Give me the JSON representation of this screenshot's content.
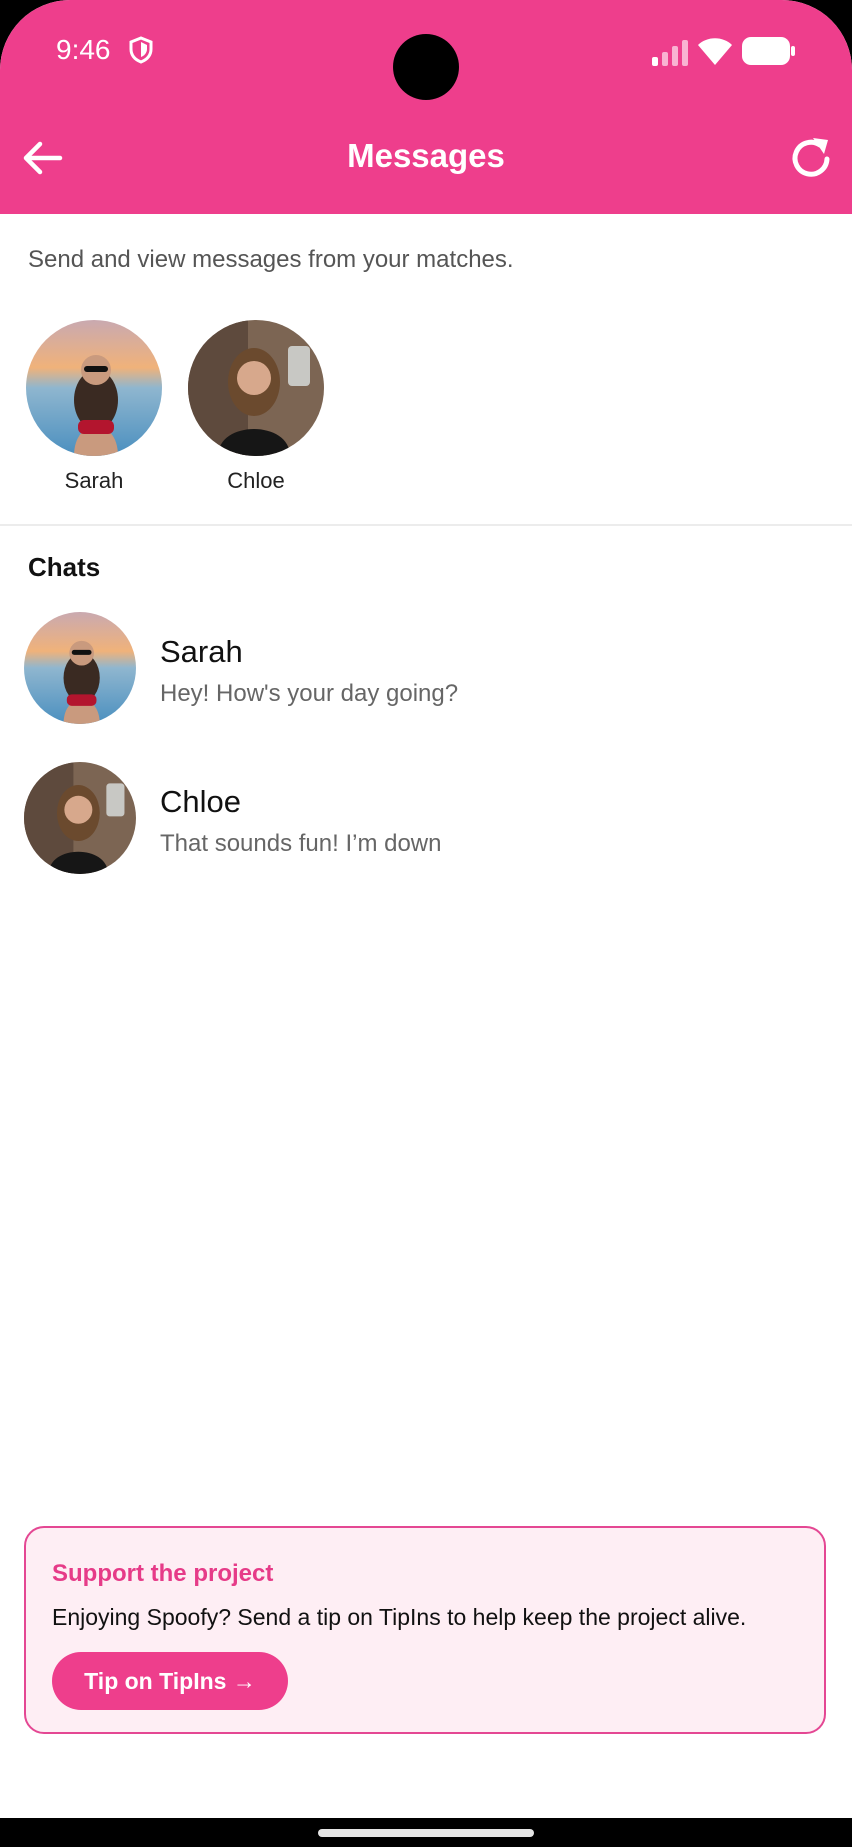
{
  "status_bar": {
    "time": "9:46"
  },
  "header": {
    "title": "Messages"
  },
  "subtitle": "Send and view messages from your matches.",
  "matches": [
    {
      "name": "Sarah"
    },
    {
      "name": "Chloe"
    }
  ],
  "chats_heading": "Chats",
  "chats": [
    {
      "name": "Sarah",
      "last_message": "Hey! How's your day going?"
    },
    {
      "name": "Chloe",
      "last_message": "That sounds fun! I’m down"
    }
  ],
  "support": {
    "title": "Support the project",
    "text": "Enjoying Spoofy? Send a tip on TipIns to help keep the project alive.",
    "button_label": "Tip on TipIns →"
  },
  "colors": {
    "accent": "#EE3E8C",
    "support_bg": "#FEEEF4",
    "support_border": "#E44793"
  },
  "icons": [
    "shield-icon",
    "signal-icon",
    "wifi-icon",
    "battery-icon",
    "back-arrow-icon",
    "refresh-icon"
  ]
}
